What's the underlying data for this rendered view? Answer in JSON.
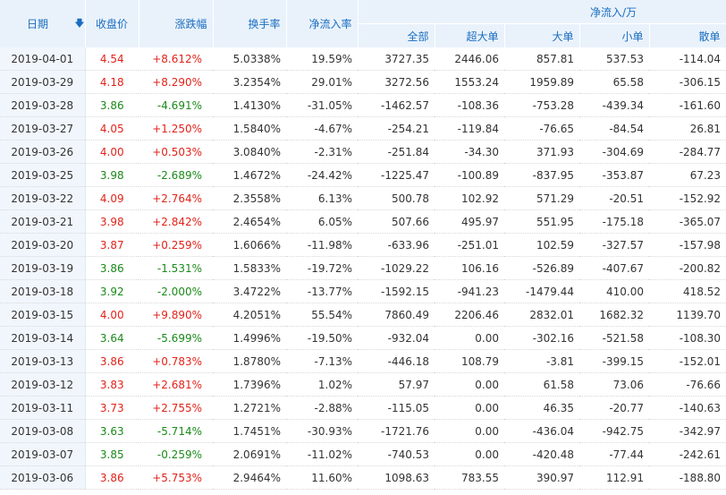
{
  "headers": {
    "date": "日期",
    "close": "收盘价",
    "change_pct": "涨跌幅",
    "turnover": "换手率",
    "net_inflow_rate": "净流入率",
    "net_inflow_group": "净流入/万",
    "all": "全部",
    "super_large": "超大单",
    "large": "大单",
    "small": "小单",
    "retail": "散单",
    "sort_arrow": "🡇"
  },
  "colors": {
    "up": "#e2231a",
    "down": "#1a8a1a",
    "header_text": "#1a6dc0",
    "header_bg": "#e9f2fb"
  },
  "rows": [
    {
      "date": "2019-04-01",
      "close": "4.54",
      "change": "+8.612%",
      "turnover": "5.0338%",
      "rate": "19.59%",
      "all": "3727.35",
      "super": "2446.06",
      "large": "857.81",
      "small": "537.53",
      "retail": "-114.04",
      "dir": "up"
    },
    {
      "date": "2019-03-29",
      "close": "4.18",
      "change": "+8.290%",
      "turnover": "3.2354%",
      "rate": "29.01%",
      "all": "3272.56",
      "super": "1553.24",
      "large": "1959.89",
      "small": "65.58",
      "retail": "-306.15",
      "dir": "up"
    },
    {
      "date": "2019-03-28",
      "close": "3.86",
      "change": "-4.691%",
      "turnover": "1.4130%",
      "rate": "-31.05%",
      "all": "-1462.57",
      "super": "-108.36",
      "large": "-753.28",
      "small": "-439.34",
      "retail": "-161.60",
      "dir": "down"
    },
    {
      "date": "2019-03-27",
      "close": "4.05",
      "change": "+1.250%",
      "turnover": "1.5840%",
      "rate": "-4.67%",
      "all": "-254.21",
      "super": "-119.84",
      "large": "-76.65",
      "small": "-84.54",
      "retail": "26.81",
      "dir": "up"
    },
    {
      "date": "2019-03-26",
      "close": "4.00",
      "change": "+0.503%",
      "turnover": "3.0840%",
      "rate": "-2.31%",
      "all": "-251.84",
      "super": "-34.30",
      "large": "371.93",
      "small": "-304.69",
      "retail": "-284.77",
      "dir": "up"
    },
    {
      "date": "2019-03-25",
      "close": "3.98",
      "change": "-2.689%",
      "turnover": "1.4672%",
      "rate": "-24.42%",
      "all": "-1225.47",
      "super": "-100.89",
      "large": "-837.95",
      "small": "-353.87",
      "retail": "67.23",
      "dir": "down"
    },
    {
      "date": "2019-03-22",
      "close": "4.09",
      "change": "+2.764%",
      "turnover": "2.3558%",
      "rate": "6.13%",
      "all": "500.78",
      "super": "102.92",
      "large": "571.29",
      "small": "-20.51",
      "retail": "-152.92",
      "dir": "up"
    },
    {
      "date": "2019-03-21",
      "close": "3.98",
      "change": "+2.842%",
      "turnover": "2.4654%",
      "rate": "6.05%",
      "all": "507.66",
      "super": "495.97",
      "large": "551.95",
      "small": "-175.18",
      "retail": "-365.07",
      "dir": "up"
    },
    {
      "date": "2019-03-20",
      "close": "3.87",
      "change": "+0.259%",
      "turnover": "1.6066%",
      "rate": "-11.98%",
      "all": "-633.96",
      "super": "-251.01",
      "large": "102.59",
      "small": "-327.57",
      "retail": "-157.98",
      "dir": "up"
    },
    {
      "date": "2019-03-19",
      "close": "3.86",
      "change": "-1.531%",
      "turnover": "1.5833%",
      "rate": "-19.72%",
      "all": "-1029.22",
      "super": "106.16",
      "large": "-526.89",
      "small": "-407.67",
      "retail": "-200.82",
      "dir": "down"
    },
    {
      "date": "2019-03-18",
      "close": "3.92",
      "change": "-2.000%",
      "turnover": "3.4722%",
      "rate": "-13.77%",
      "all": "-1592.15",
      "super": "-941.23",
      "large": "-1479.44",
      "small": "410.00",
      "retail": "418.52",
      "dir": "down"
    },
    {
      "date": "2019-03-15",
      "close": "4.00",
      "change": "+9.890%",
      "turnover": "4.2051%",
      "rate": "55.54%",
      "all": "7860.49",
      "super": "2206.46",
      "large": "2832.01",
      "small": "1682.32",
      "retail": "1139.70",
      "dir": "up"
    },
    {
      "date": "2019-03-14",
      "close": "3.64",
      "change": "-5.699%",
      "turnover": "1.4996%",
      "rate": "-19.50%",
      "all": "-932.04",
      "super": "0.00",
      "large": "-302.16",
      "small": "-521.58",
      "retail": "-108.30",
      "dir": "down"
    },
    {
      "date": "2019-03-13",
      "close": "3.86",
      "change": "+0.783%",
      "turnover": "1.8780%",
      "rate": "-7.13%",
      "all": "-446.18",
      "super": "108.79",
      "large": "-3.81",
      "small": "-399.15",
      "retail": "-152.01",
      "dir": "up"
    },
    {
      "date": "2019-03-12",
      "close": "3.83",
      "change": "+2.681%",
      "turnover": "1.7396%",
      "rate": "1.02%",
      "all": "57.97",
      "super": "0.00",
      "large": "61.58",
      "small": "73.06",
      "retail": "-76.66",
      "dir": "up"
    },
    {
      "date": "2019-03-11",
      "close": "3.73",
      "change": "+2.755%",
      "turnover": "1.2721%",
      "rate": "-2.88%",
      "all": "-115.05",
      "super": "0.00",
      "large": "46.35",
      "small": "-20.77",
      "retail": "-140.63",
      "dir": "up"
    },
    {
      "date": "2019-03-08",
      "close": "3.63",
      "change": "-5.714%",
      "turnover": "1.7451%",
      "rate": "-30.93%",
      "all": "-1721.76",
      "super": "0.00",
      "large": "-436.04",
      "small": "-942.75",
      "retail": "-342.97",
      "dir": "down"
    },
    {
      "date": "2019-03-07",
      "close": "3.85",
      "change": "-0.259%",
      "turnover": "2.0691%",
      "rate": "-11.02%",
      "all": "-740.53",
      "super": "0.00",
      "large": "-420.48",
      "small": "-77.44",
      "retail": "-242.61",
      "dir": "down"
    },
    {
      "date": "2019-03-06",
      "close": "3.86",
      "change": "+5.753%",
      "turnover": "2.9464%",
      "rate": "11.60%",
      "all": "1098.63",
      "super": "783.55",
      "large": "390.97",
      "small": "112.91",
      "retail": "-188.80",
      "dir": "up"
    }
  ]
}
